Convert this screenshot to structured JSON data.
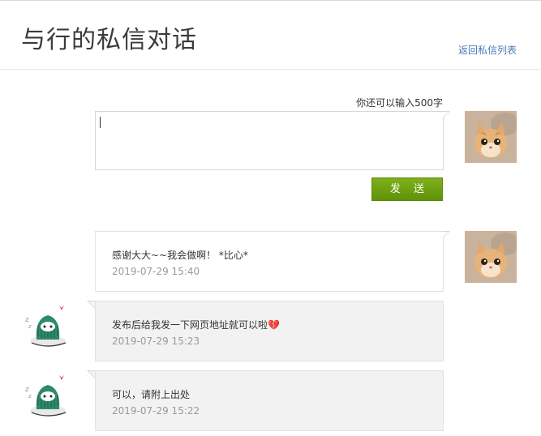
{
  "page": {
    "title": "与行的私信对话",
    "back_link": "返回私信列表"
  },
  "composer": {
    "counter": "你还可以输入500字",
    "value": "",
    "send_label": "发 送"
  },
  "avatars": {
    "me": "cat-photo-avatar",
    "other": "green-owl-cartoon-avatar"
  },
  "messages": [
    {
      "from": "me",
      "text": "感谢大大~~我会做啊！ *比心*",
      "time": "2019-07-29 15:40"
    },
    {
      "from": "other",
      "text": "发布后给我发一下网页地址就可以啦💔",
      "time": "2019-07-29 15:23"
    },
    {
      "from": "other",
      "text": "可以，请附上出处",
      "time": "2019-07-29 15:22"
    }
  ],
  "colors": {
    "send_button": "#6ea312",
    "link": "#4a7ab8",
    "their_bubble": "#f2f2f2"
  }
}
